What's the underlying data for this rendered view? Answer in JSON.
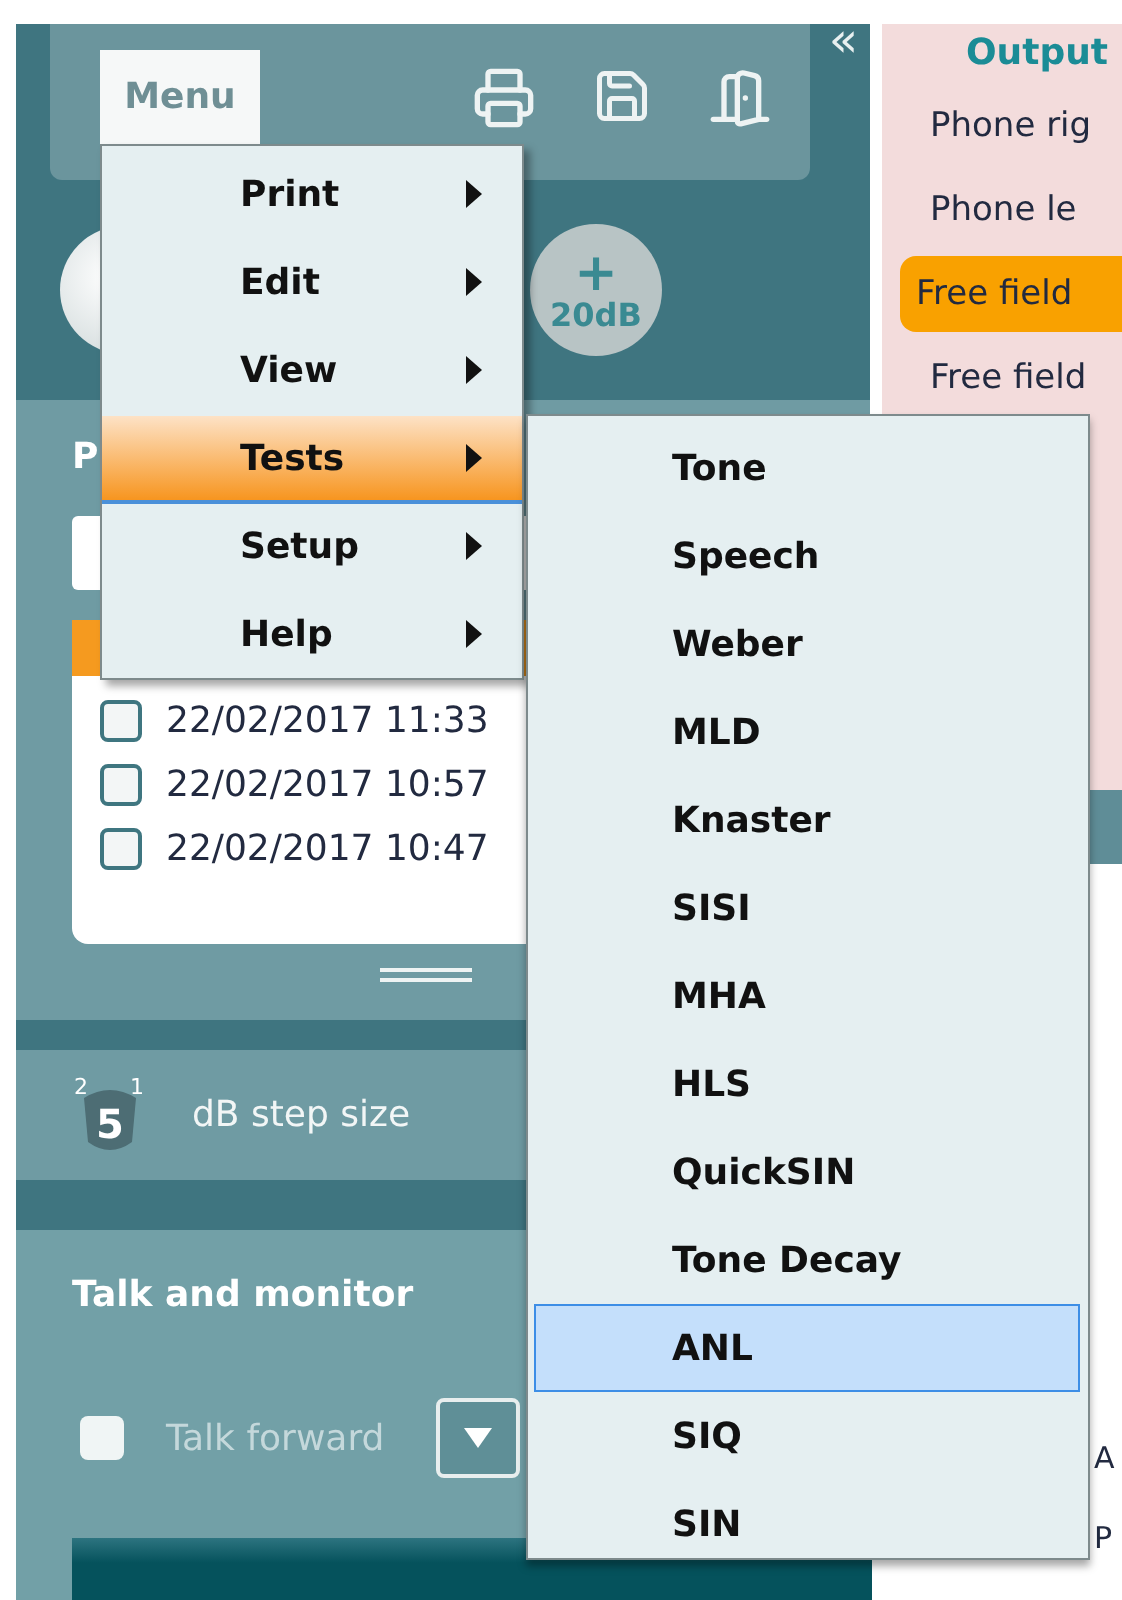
{
  "toolbar": {
    "menu_button": "Menu",
    "collapse_button": "«"
  },
  "level_button": {
    "symbol": "+",
    "label": "20dB"
  },
  "session_panel": {
    "title": "P",
    "sessions": [
      {
        "label": "22/02/2017 11:33",
        "checked": false
      },
      {
        "label": "22/02/2017 10:57",
        "checked": false
      },
      {
        "label": "22/02/2017 10:47",
        "checked": false
      }
    ]
  },
  "step_size": {
    "icon_digits": [
      "2",
      "5",
      "1"
    ],
    "label": "dB step size"
  },
  "talk_monitor": {
    "title": "Talk and monitor",
    "talk_forward": {
      "label": "Talk forward",
      "checked": false,
      "disabled": true
    }
  },
  "output_panel": {
    "title": "Output",
    "options": [
      {
        "label": "Phone rig",
        "selected": false
      },
      {
        "label": "Phone le",
        "selected": false
      },
      {
        "label": "Free field",
        "selected": true
      },
      {
        "label": "Free field",
        "selected": false
      }
    ]
  },
  "lower_right": {
    "texts": [
      "A",
      "P"
    ]
  },
  "menu": {
    "items": [
      {
        "label": "Print",
        "selected": false
      },
      {
        "label": "Edit",
        "selected": false
      },
      {
        "label": "View",
        "selected": false
      },
      {
        "label": "Tests",
        "selected": true
      },
      {
        "label": "Setup",
        "selected": false
      },
      {
        "label": "Help",
        "selected": false
      }
    ]
  },
  "submenu": {
    "items": [
      {
        "label": "Tone",
        "selected": false
      },
      {
        "label": "Speech",
        "selected": false
      },
      {
        "label": "Weber",
        "selected": false
      },
      {
        "label": "MLD",
        "selected": false
      },
      {
        "label": "Knaster",
        "selected": false
      },
      {
        "label": "SISI",
        "selected": false
      },
      {
        "label": "MHA",
        "selected": false
      },
      {
        "label": "HLS",
        "selected": false
      },
      {
        "label": "QuickSIN",
        "selected": false
      },
      {
        "label": "Tone Decay",
        "selected": false
      },
      {
        "label": "ANL",
        "selected": true
      },
      {
        "label": "SIQ",
        "selected": false
      },
      {
        "label": "SIN",
        "selected": false
      }
    ]
  }
}
